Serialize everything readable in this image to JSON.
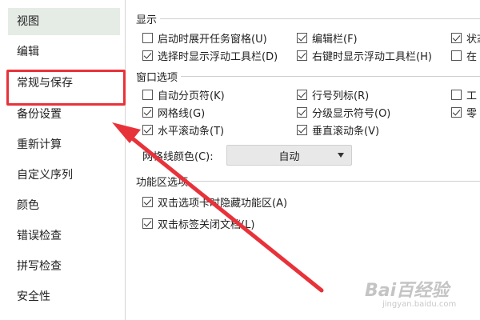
{
  "sidebar": {
    "items": [
      {
        "label": "视图",
        "selected": true
      },
      {
        "label": "编辑",
        "selected": false
      },
      {
        "label": "常规与保存",
        "selected": false,
        "highlighted": true
      },
      {
        "label": "备份设置",
        "selected": false
      },
      {
        "label": "重新计算",
        "selected": false
      },
      {
        "label": "自定义序列",
        "selected": false
      },
      {
        "label": "颜色",
        "selected": false
      },
      {
        "label": "错误检查",
        "selected": false
      },
      {
        "label": "拼写检查",
        "selected": false
      },
      {
        "label": "安全性",
        "selected": false
      }
    ]
  },
  "display": {
    "title": "显示",
    "options": [
      {
        "label": "启动时展开任务窗格(U)",
        "checked": false
      },
      {
        "label": "编辑栏(F)",
        "checked": true
      },
      {
        "label": "状态",
        "checked": true
      },
      {
        "label": "选择时显示浮动工具栏(D)",
        "checked": true
      },
      {
        "label": "右键时显示浮动工具栏(H)",
        "checked": true
      },
      {
        "label": "在",
        "checked": false
      }
    ]
  },
  "window": {
    "title": "窗口选项",
    "options": [
      {
        "label": "自动分页符(K)",
        "checked": false
      },
      {
        "label": "行号列标(R)",
        "checked": true
      },
      {
        "label": "工",
        "checked": false
      },
      {
        "label": "网格线(G)",
        "checked": true
      },
      {
        "label": "分级显示符号(O)",
        "checked": true
      },
      {
        "label": "零",
        "checked": true
      },
      {
        "label": "水平滚动条(T)",
        "checked": true
      },
      {
        "label": "垂直滚动条(V)",
        "checked": true
      }
    ],
    "grid_color_label": "网格线颜色(C):",
    "grid_color_value": "自动"
  },
  "ribbon": {
    "title": "功能区选项",
    "options": [
      {
        "label": "双击选项卡时隐藏功能区(A)",
        "checked": true
      },
      {
        "label": "双击标签关闭文档(L)",
        "checked": true
      }
    ]
  },
  "watermark": {
    "text": "Bai百经验",
    "sub": "jingyan.baidu.com"
  },
  "colors": {
    "annotation_red": "#e8323a",
    "selected_bg": "#e5ebe5"
  }
}
